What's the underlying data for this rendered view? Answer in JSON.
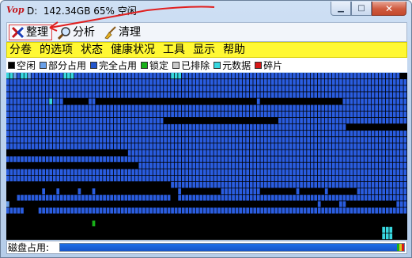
{
  "window": {
    "title": "D:  142.34GB 65% 空闲",
    "logo_text": "Vop",
    "buttons": {
      "minimize": "▁",
      "maximize": "□",
      "close": "✕"
    }
  },
  "toolbar": {
    "defrag_label": "整理",
    "analyze_label": "分析",
    "clean_label": "清理"
  },
  "menu": [
    "分卷",
    "的选项",
    "状态",
    "健康状况",
    "工具",
    "显示",
    "帮助"
  ],
  "legend": [
    {
      "label": "空闲",
      "color": "#000000"
    },
    {
      "label": "部分占用",
      "color": "#6aa0e8"
    },
    {
      "label": "完全占用",
      "color": "#2255cc"
    },
    {
      "label": "锁定",
      "color": "#18b018"
    },
    {
      "label": "已排除",
      "color": "#c8c8c8"
    },
    {
      "label": "元数据",
      "color": "#38d8e0"
    },
    {
      "label": "碎片",
      "color": "#d81818"
    }
  ],
  "colors": {
    "free": "#000000",
    "full": "#2a5de0",
    "partial": "#6aa0e8",
    "metadata": "#38d8e0",
    "locked": "#18b018",
    "fragment": "#d81818"
  },
  "cluster_map": {
    "rows": [
      "ccsbccsbbbbbbbbbcccbbbbbbbbbbbbbbbbbbbbbbbbbbbcccbbbbbbbbbbbbbbbbbbbbbbbbbbbbbbbbbbbbbbbbbbbbbbbbbbbbbbbbbbbbb",
      "bbbbbbbbbbbbbbbbbbbbbbbbbbbbbbbbbbbbbbbbbbbbbbbbbbbbbbbbbbbbbbbbbbbbbbbbbbbbbbbbbbbbbbbbbbbbbbbbbbbbbbbbbbbbbbbb",
      "bbbbbbbbbbbbbbbbbbbbbbbbbbbbbbbbbbbbbbbbbbbbbbbbbbbbbbbbbbbbbbbbbbbbbbbbbbbbbbbbbbbbbbbbbbbbbbbbbbbbbbbbbbbbbbbb",
      "bbbbbbbbbbbbbbbbbbbbbbbbbbbbbbbbbbbbbbbbbbbbbbbbbbbbbbbbbbbbbbbbbbbbbbbbbbbbbbbbbbbbbbbbbbbbbbbbbbbbbbbbbbbbbbbb",
      "bbbbbbbbbbbbcbbb.......bb.............................................b.......................bbbbbbbbbbbbbbbbbbbb",
      "bbbbbbbbbbbbbbbbbbbbbbbbbbbbbbbbbbbbbbbbbbbbbbbbbbbbbbbbbbbbbbbbbbbbbbbbbbbbbbbbbbbbbbbbbbbbbbbbbbbbbbbbbbbbbbbb",
      "bbbbbbbbbbbbbbbbbbbbbbbbbbbbbbbbbbbbbbbbbbbbbbbbbbbbbbbbbbbbbbbbbbbbbbbbbbbbbbbbbbbbbbbbbbbbbbbbbbbbbbbbbbbbbbbb",
      "bbbbbbbbbbbbbbbbbbbbbbbbbbbbbbbbbbbbbbbbbbbb................................bbbbbbbbbbbbbbbbbbbbbbbbbbbbbbbbbbbbbbbb",
      "bbbbbbbbbbbbbbbbbbbbbbbbbbbbbbbbbbbbbbbbbbbbbbbbbbbbbbbbbbbbbbbbbbbbbbbbbbbbbbbbbbbbbbbbbbbbbbb...................",
      "bbbbbbbbbbbbbbbbbbbbbbbbbbbbbbbbbbbbbbbbbbbbbbbbbbbbbbbbbbbbbbbbbbbbbbbbbbbbbbbbbbbbbbbbbbbbbbbbbbbbbbbbbbbbbbbb",
      "bbbbbbbbbbbbbbbbbbbbbbbbbbbbbbbbbbbbbbbbbbbbbbbbbbbbbbbbbbbbbbbbbbbbbbbbbbbbbbbbbbbbbbbbbbbbbbbbbbbbbbbbbbbbbbbb",
      "bbbbbbbbbbbbbbbbbbbbbbbbbbbbbbbbbbbbbbbbbbbbbbbbbbbbbbbbbbbbbbbbbbbbbbbbbbbbbbbbbbbbbbbbbbbbbbbbbbbbbbbbbbbbbbbb",
      "..................................bbbbbbbbbbbbbbbbbbbbbbbbbbbbbbbbbbbbbbbbbbbbbbbbbbbbbbbbbbbbbbbbbbbbbbbbbbbbbbbbbbbbb",
      "bbbbbbbbbbbbbbbbbbbbbbbbbbbbbbbbbbbbbbbbbbbbbbbbbbbbbbbbbbbbbbbbbbbbbbbbbbbbbbbbbbbbbbbbbbbbbbbbbbbbbbbbbbbbbbbb",
      ".....................................bbbbbbbbbbbbbbbbbbbbbbbbbbbbbbbbbbbbbbbbbbbbbbbbbbbbbbbbbbbbbbbbbbbbbbbbbbbbbbbbbbbbbbbbbbbb",
      "bbbbbbbbbbbbbbbbbbbbbbbbbbbbbbbbbbbbbbbbbbbbbbbbbbbbbbbbbbbbbbbbbbbbbbbbbbbbbbbbbbbbbbbbbbbbbbbbbbbbbbbbbbbbbbbb",
      "bbbbbbbbbbbbbbbbbbbbbbbbbbbbbbbbbbbbbbbbbbbbbbbbbbbbbbbbbbbbbbbbbbbbbbbbbbbbbbbbbbbbbbbbbbbbbbbbbbbbbbbbbbbbbbbb",
      "..............................................bbbbbbbbbbbbbbbbbbbbbbbbbbbbbbbbbbbbbbbbbbbbbbbbbbbbbbbbbbbbbbbbbbbbbbbbbbbbbbbbbbbbbbbb",
      "..........b...b.....b...b.......................b...........bbbbbbbbbbb..........b.......b........bbbbbbbbbbbbbbbbb",
      "...bbbbbbbbbbbbbbbbbbbbbbbbbbbbbbbbbbbbbbbbbbb..bbbbbbbbbbbbbbbbbbbbbbbbbbbbbbbbbbbbbbbbbbbbbbbbbbbbbbbbbbbbbbbbbbb",
      "s......................................................................................b.....bb..............bbbb",
      "bbbbb....bbbbbbbbbbbbbbbbbbbbbbbbbbbbbbbbbbbbbbbbbbbbbbbbbbbbbbbbbbbbbbbbbbbbbbbbbbbbbbbbbbbbbbbbbbbbbbbbbbbbbbb",
      "................................................................................................................",
      "........................g.......................................................................................",
      ".........................................................................................................ccc....",
      ".........................................................................................................ccc...."
    ]
  },
  "status": {
    "label": "磁盘占用:",
    "used_fraction": 0.985
  }
}
